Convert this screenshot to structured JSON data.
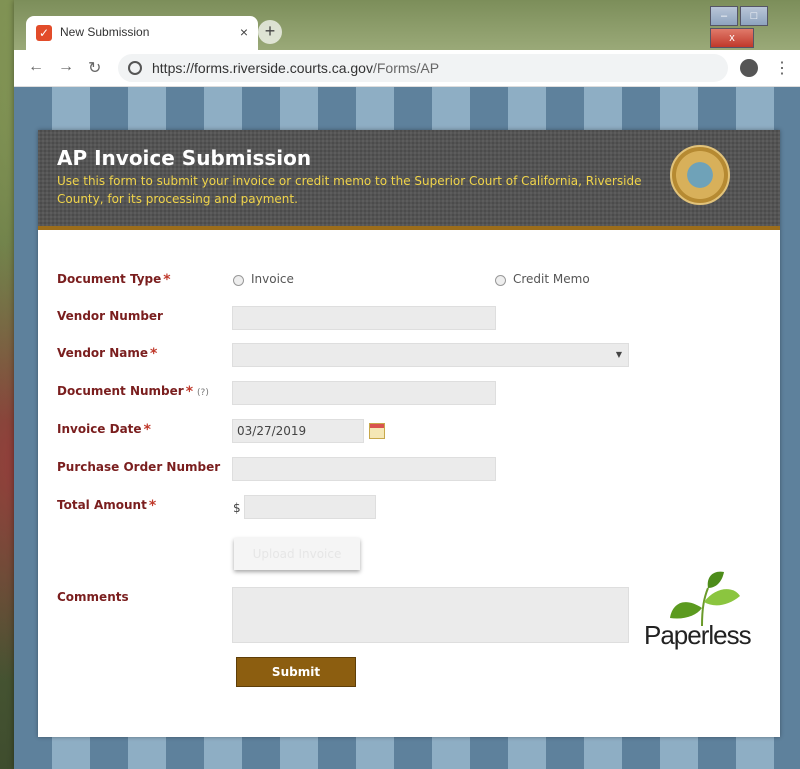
{
  "browser": {
    "tab_title": "New Submission",
    "tab_close": "×",
    "new_tab": "+",
    "url_host": "https://forms.riverside.courts.ca.gov",
    "url_path": "/Forms/AP",
    "window_controls": [
      "–",
      "□",
      "x"
    ]
  },
  "header": {
    "title": "AP Invoice Submission",
    "subtitle": "Use this form to submit your invoice or credit memo to the Superior Court of California, Riverside County, for its processing and payment."
  },
  "form": {
    "document_type_label": "Document Type",
    "option_invoice": "Invoice",
    "option_credit_memo": "Credit Memo",
    "vendor_number_label": "Vendor Number",
    "vendor_name_label": "Vendor Name",
    "document_number_label": "Document Number",
    "document_number_help": "(?)",
    "invoice_date_label": "Invoice Date",
    "invoice_date_value": "03/27/2019",
    "po_number_label": "Purchase Order Number",
    "total_amount_label": "Total Amount",
    "currency_symbol": "$",
    "upload_label": "Upload Invoice",
    "comments_label": "Comments",
    "submit_label": "Submit",
    "required_mark": "*"
  },
  "logo": {
    "text": "Paperless"
  },
  "colors": {
    "label": "#7a1e1e",
    "header_bg": "#4b4b4b",
    "header_subtitle": "#f0d44a",
    "accent_bar": "#9c6d1a",
    "submit_bg": "#8c5e10"
  }
}
